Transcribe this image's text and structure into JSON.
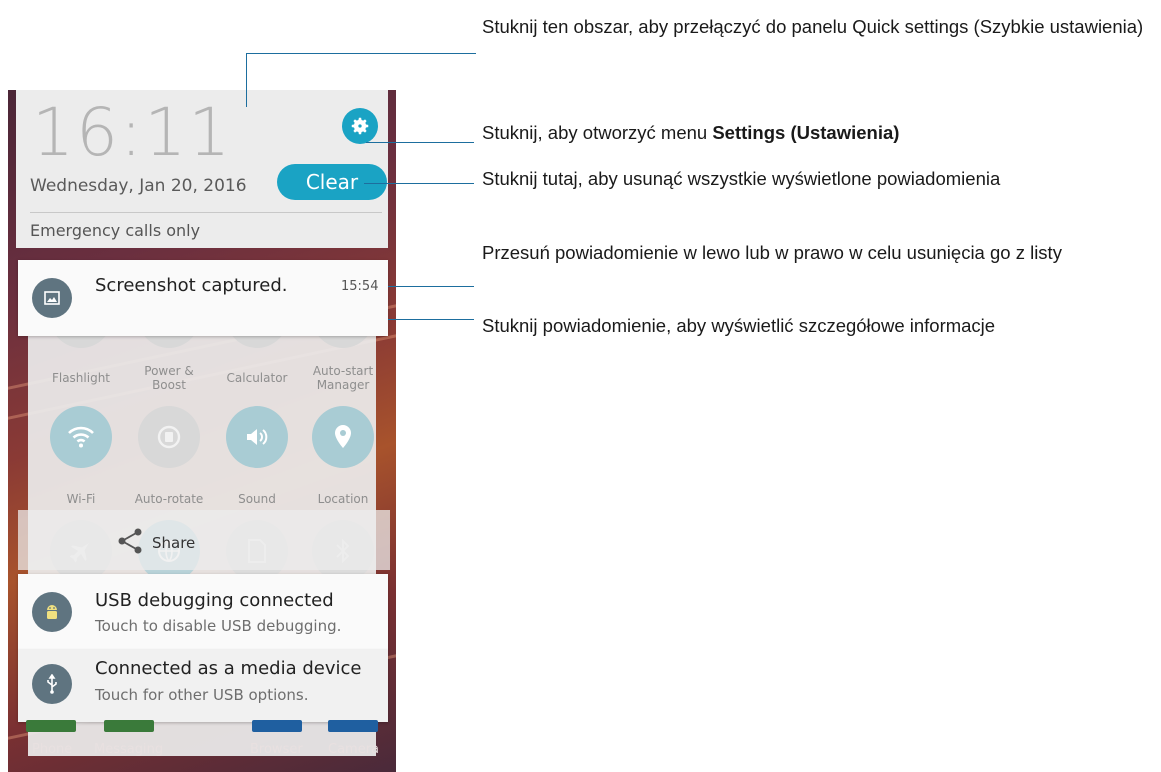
{
  "annotations": {
    "quick_settings": "Stuknij ten obszar, aby przełączyć do panelu Quick settings (Szybkie ustawienia)",
    "settings_prefix": "Stuknij, aby otworzyć menu ",
    "settings_bold": "Settings (Ustawienia)",
    "clear": "Stuknij tutaj, aby usunąć wszystkie wyświetlone powiadomienia",
    "swipe": "Przesuń powiadomienie w lewo lub w prawo w celu usunięcia go z listy",
    "tap_notification": "Stuknij powiadomienie, aby wyświetlić szczegółowe informacje"
  },
  "header": {
    "time": "16:11",
    "date": "Wednesday, Jan 20, 2016",
    "clear_label": "Clear",
    "status": "Emergency calls only"
  },
  "notifications": [
    {
      "title": "Screenshot captured.",
      "time": "15:54",
      "icon": "image-icon"
    },
    {
      "title": "USB debugging connected",
      "subtitle": "Touch to disable USB debugging.",
      "icon": "android-icon"
    },
    {
      "title": "Connected as a media device",
      "subtitle": "Touch for other USB options.",
      "icon": "usb-icon"
    }
  ],
  "quick_settings": {
    "row1": [
      "Flashlight",
      "Power & Boost",
      "Calculator",
      "Auto-start Manager"
    ],
    "row2": [
      "Wi-Fi",
      "Auto-rotate",
      "Sound",
      "Location"
    ],
    "active": [
      "Wi-Fi",
      "Sound",
      "Location"
    ],
    "row3_icons": [
      "airplane-icon",
      "globe-icon",
      "sim-icon",
      "bluetooth-icon"
    ]
  },
  "share": {
    "label": "Share",
    "icon": "share-icon"
  },
  "dock": [
    "Phone",
    "Messaging",
    "Browser",
    "Camera"
  ],
  "colors": {
    "accent": "#1aa3c4",
    "callout_line": "#1d6e9e",
    "notification_icon": "#5f7480",
    "qs_active": "#a9ccd4",
    "qs_inactive": "#d8d8d8"
  }
}
